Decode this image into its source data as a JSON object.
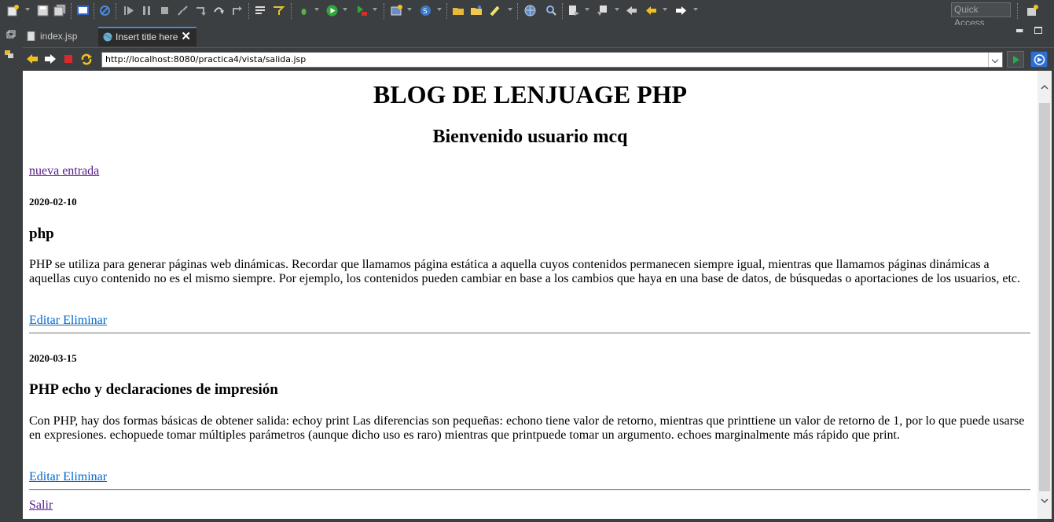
{
  "toolbar": {
    "quick_access_label": "Quick Access",
    "icons": [
      "new-icon",
      "save-icon",
      "save-all-icon",
      "print-icon",
      "skip-breakpoints-icon",
      "resume-icon",
      "suspend-icon",
      "terminate-icon",
      "disconnect-icon",
      "step-into-icon",
      "step-over-icon",
      "step-return-icon",
      "toggle-mark-icon",
      "debug-icon",
      "run-icon",
      "run-external-icon",
      "new-server-icon",
      "deploy-icon",
      "open-folder-icon",
      "open-type-icon",
      "brush-icon",
      "globe-icon",
      "search-icon",
      "annotation-icon",
      "next-annotation-icon",
      "back-icon",
      "forward-icon",
      "perspective-icon"
    ]
  },
  "tabs": [
    {
      "label": "index.jsp",
      "active": false,
      "icon": "jsp-file-icon"
    },
    {
      "label": "Insert title here",
      "active": true,
      "icon": "globe-icon"
    }
  ],
  "browser": {
    "url": "http://localhost:8080/practica4/vista/salida.jsp"
  },
  "page": {
    "title": "BLOG DE LENJUAGE PHP",
    "welcome": "Bienvenido usuario mcq",
    "new_entry_link": "nueva entrada",
    "posts": [
      {
        "date": "2020-02-10",
        "title": "php",
        "body": "PHP se utiliza para generar páginas web dinámicas. Recordar que llamamos página estática a aquella cuyos contenidos permanecen siempre igual, mientras que llamamos páginas dinámicas a aquellas cuyo contenido no es el mismo siempre. Por ejemplo, los contenidos pueden cambiar en base a los cambios que haya en una base de datos, de búsquedas o aportaciones de los usuarios, etc.",
        "actions": "Editar Eliminar"
      },
      {
        "date": "2020-03-15",
        "title": "PHP echo y declaraciones de impresión",
        "body": "Con PHP, hay dos formas básicas de obtener salida: echoy print Las diferencias son pequeñas: echono tiene valor de retorno, mientras que printtiene un valor de retorno de 1, por lo que puede usarse en expresiones. echopuede tomar múltiples parámetros (aunque dicho uso es raro) mientras que printpuede tomar un argumento. echoes marginalmente más rápido que print.",
        "actions": "Editar Eliminar"
      }
    ],
    "logout_link": "Salir"
  },
  "colors": {
    "ide_background": "#3c3f41",
    "link": "#0066cc",
    "visited_link": "#551a8b",
    "active_tab_accent": "#4a88c7"
  }
}
